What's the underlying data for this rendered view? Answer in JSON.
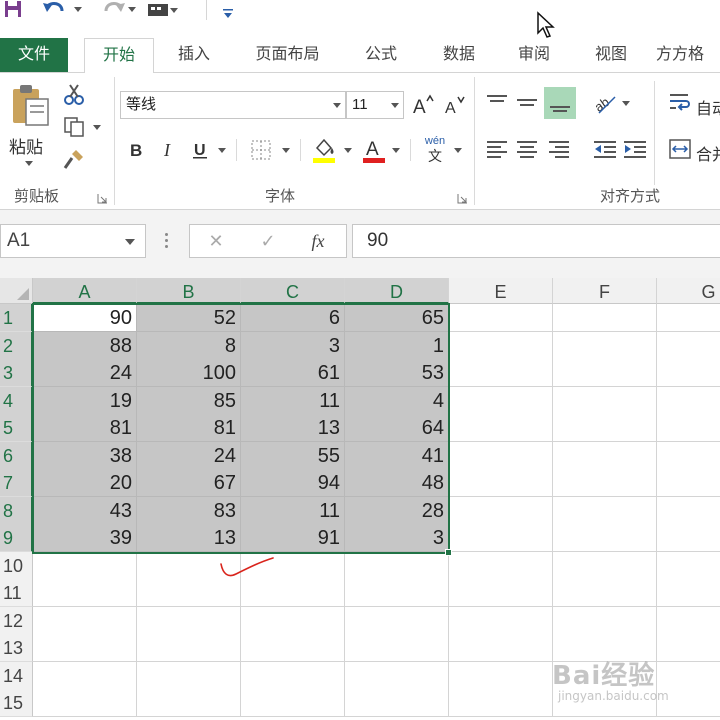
{
  "ribbon": {
    "tabs": [
      "文件",
      "开始",
      "插入",
      "页面布局",
      "公式",
      "数据",
      "审阅",
      "视图",
      "方方格"
    ],
    "active_tab": "开始",
    "clipboard": {
      "paste_label": "粘贴",
      "group_label": "剪贴板"
    },
    "font": {
      "name": "等线",
      "size": "11",
      "group_label": "字体",
      "phonetic_top": "wén",
      "phonetic_bottom": "文"
    },
    "alignment": {
      "group_label": "对齐方式",
      "wrap_label": "自动",
      "merge_label": "合并"
    }
  },
  "formula_bar": {
    "name_box": "A1",
    "fx_label": "fx",
    "value": "90"
  },
  "sheet": {
    "columns": [
      "A",
      "B",
      "C",
      "D",
      "E",
      "F",
      "G"
    ],
    "rows": [
      "1",
      "2",
      "3",
      "4",
      "5",
      "6",
      "7",
      "8",
      "9",
      "10",
      "11",
      "12",
      "13",
      "14",
      "15"
    ],
    "cells": [
      [
        "90",
        "52",
        "6",
        "65"
      ],
      [
        "88",
        "8",
        "3",
        "1"
      ],
      [
        "24",
        "100",
        "61",
        "53"
      ],
      [
        "19",
        "85",
        "11",
        "4"
      ],
      [
        "81",
        "81",
        "13",
        "64"
      ],
      [
        "38",
        "24",
        "55",
        "41"
      ],
      [
        "20",
        "67",
        "94",
        "48"
      ],
      [
        "43",
        "83",
        "11",
        "28"
      ],
      [
        "39",
        "13",
        "91",
        "3"
      ]
    ],
    "selection": "A1:D9"
  },
  "watermark": {
    "main": "Bai经验",
    "sub": "jingyan.baidu.com"
  },
  "colors": {
    "excel_green": "#217346",
    "selection_fill": "#c6c6c6",
    "annotation": "#d9241c"
  }
}
